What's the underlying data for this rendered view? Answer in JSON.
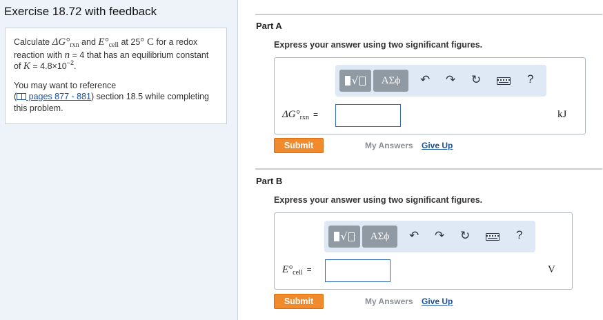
{
  "exercise_title": "Exercise 18.72 with feedback",
  "problem": {
    "calc_prefix": "Calculate ",
    "dg_symbol": "ΔG°",
    "dg_sub": "rxn",
    "and_text": " and ",
    "e_symbol": "E°",
    "e_sub": "cell",
    "at_text": " at 25",
    "deg_c": "° C",
    "redox_text": " for a redox reaction with ",
    "n_symbol": "n",
    "n_value": " = 4 that has an equilibrium constant of ",
    "k_symbol": "K",
    "k_value": " = 4.8×10",
    "k_exp": "−2",
    "k_end": ".",
    "ref_line1": "You may want to reference",
    "ref_link": " pages 877 - 881",
    "ref_line2": ") section 18.5 while completing this problem."
  },
  "parts": [
    {
      "label": "Part A",
      "instruction": "Express your answer using two significant figures.",
      "var_symbol": "ΔG°",
      "var_sub": "rxn",
      "equals": "=",
      "input_value": "",
      "unit": "kJ",
      "toolbar": {
        "greek_label": "ΑΣϕ",
        "help_label": "?"
      },
      "submit_label": "Submit",
      "my_answers_label": "My Answers",
      "give_up_label": "Give Up"
    },
    {
      "label": "Part B",
      "instruction": "Express your answer using two significant figures.",
      "var_symbol": "E°",
      "var_sub": "cell",
      "equals": "=",
      "input_value": "",
      "unit": "V",
      "toolbar": {
        "greek_label": "ΑΣϕ",
        "help_label": "?"
      },
      "submit_label": "Submit",
      "my_answers_label": "My Answers",
      "give_up_label": "Give Up"
    }
  ],
  "icons": [
    "templates-icon",
    "greek-symbols-icon",
    "undo-icon",
    "redo-icon",
    "reset-icon",
    "keyboard-icon",
    "help-icon",
    "book-icon"
  ],
  "colors": {
    "submit": "#f18a2c",
    "link": "#1a4f9c",
    "toolbar_bg": "#dfe9f6",
    "toolbar_button": "#8f9aa3",
    "input_border": "#2f6fb0",
    "left_panel": "#eef3fa"
  }
}
